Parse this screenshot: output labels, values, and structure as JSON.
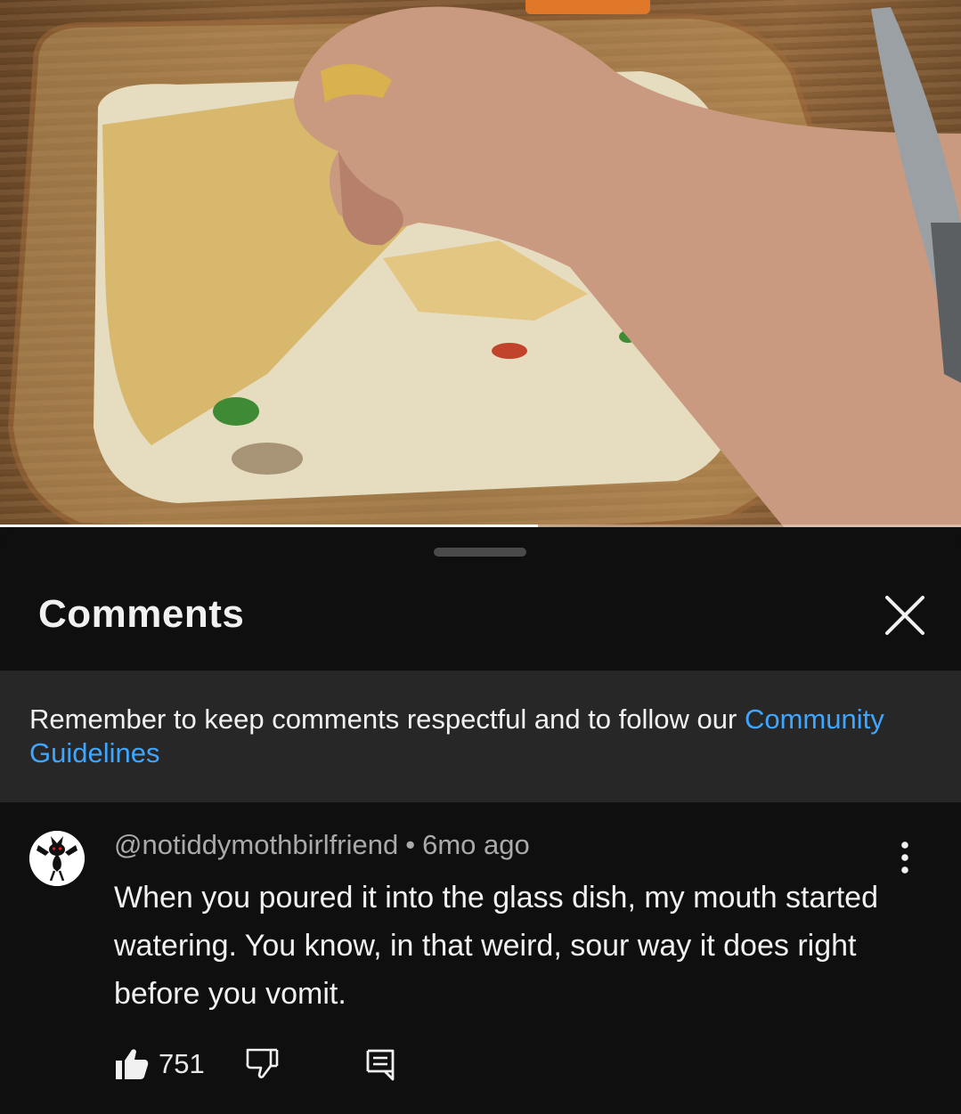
{
  "player": {
    "progress_fraction": 0.56
  },
  "panel": {
    "title": "Comments"
  },
  "banner": {
    "text": "Remember to keep comments respectful and to follow our ",
    "link_text": "Community Guidelines"
  },
  "comment": {
    "author": "@notiddymothbirlfriend",
    "separator": "•",
    "time": "6mo ago",
    "text": "When you poured it into the glass dish, my mouth started watering. You know, in that weird, sour way it does right before you vomit.",
    "likes": "751"
  },
  "icons": {
    "close": "close-icon",
    "more": "more-vertical-icon",
    "like": "thumbs-up-icon",
    "dislike": "thumbs-down-icon",
    "reply": "reply-comment-icon",
    "avatar": "creature-avatar"
  },
  "colors": {
    "background": "#0f0f0f",
    "banner": "#272727",
    "link": "#3ea6ff",
    "secondary_text": "#aaaaaa"
  }
}
